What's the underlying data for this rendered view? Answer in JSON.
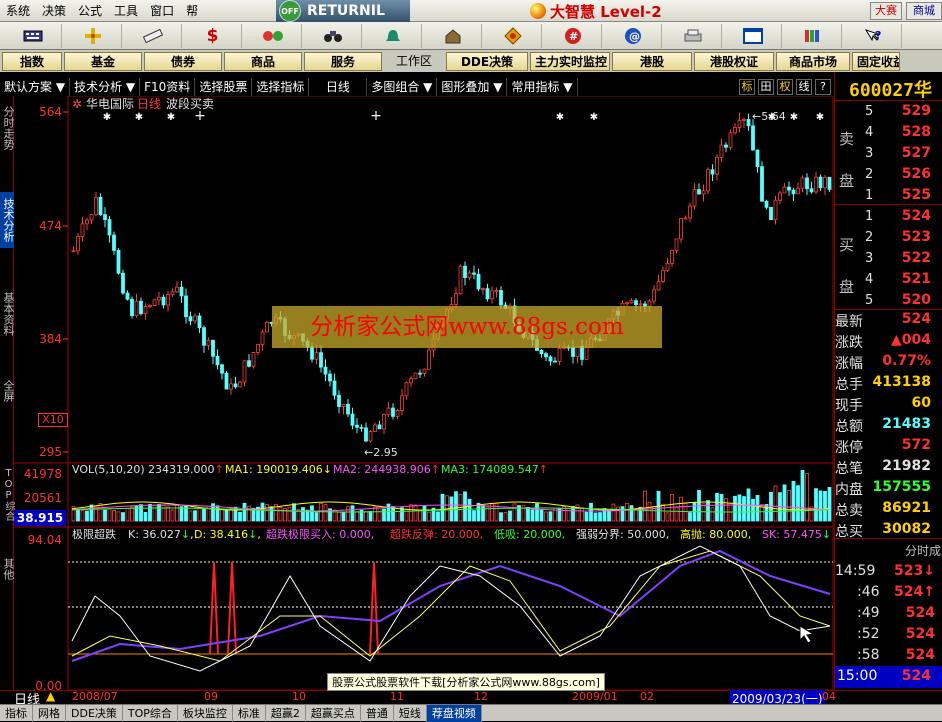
{
  "menubar": {
    "items": [
      "系统",
      "决策",
      "公式",
      "工具",
      "窗口",
      "帮"
    ],
    "returnil_badge": "OFF",
    "returnil_label": "RETURNIL",
    "brand": "大智慧 Level-2",
    "tournament": "大赛",
    "mall": "商城"
  },
  "toolbar": {
    "items": [
      {
        "icon": "keyboard-icon"
      },
      {
        "icon": "crosshair-icon"
      },
      {
        "icon": "ruler-icon"
      },
      {
        "icon": "dollar-icon",
        "label": "$"
      },
      {
        "icon": "coins-icon"
      },
      {
        "icon": "binoculars-icon"
      },
      {
        "icon": "bell-icon"
      },
      {
        "icon": "house-icon"
      },
      {
        "icon": "diamond-icon"
      },
      {
        "icon": "shield-icon"
      },
      {
        "icon": "disc-icon"
      },
      {
        "icon": "printer-icon"
      },
      {
        "icon": "window-icon"
      },
      {
        "icon": "books-icon"
      },
      {
        "icon": "help-icon"
      }
    ]
  },
  "funcbar": {
    "buttons": [
      "指数",
      "基金",
      "债券",
      "商品",
      "服务"
    ],
    "work_area": "工作区",
    "buttons2": [
      "DDE决策",
      "主力实时监控",
      "港股",
      "港股权证",
      "商品市场",
      "固定收益"
    ]
  },
  "menurow": {
    "items": [
      "默认方案",
      "技术分析",
      "F10资料",
      "选择股票",
      "选择指标",
      "日线",
      "多图组合",
      "图形叠加",
      "常用指标"
    ],
    "icons": [
      "标",
      "田",
      "权",
      "线",
      "?"
    ]
  },
  "left_tabs": [
    "分时走势",
    "技术分析",
    "基本资料",
    "全屏",
    "TOP综合",
    "其他"
  ],
  "kline": {
    "stock_name": "华电国际",
    "period": "日线",
    "indicator": "波段买卖",
    "yticks": [
      "564",
      "474",
      "384",
      "295"
    ],
    "high_label": "5.64",
    "low_label": "2.95",
    "colors": {
      "up": "#ff3c3c",
      "down": "#54ffff"
    }
  },
  "volume": {
    "title": "VOL(5,10,20)",
    "vol": "234319.000",
    "ma1_label": "MA1: 190019.406",
    "ma2_label": "MA2: 244938.906",
    "ma3_label": "MA3: 174089.547",
    "yticks": [
      "41978",
      "20561",
      "X10"
    ]
  },
  "indicator": {
    "title": "极限超跌",
    "k_label": "K: 36.027",
    "d_label": "D: 38.416",
    "buy_label": "超跌极限买入: 0.000,",
    "rebound_label": "超跌反弹: 20.000,",
    "low_label": "低吸: 20.000,",
    "strength_label": "强弱分界: 50.000,",
    "throw_label": "高抛: 80.000,",
    "sk_label": "SK: 57.475",
    "yticks": [
      "94.04",
      "38.915",
      "0.00"
    ]
  },
  "timeaxis": {
    "period": "日线",
    "labels": [
      "2008/07",
      "09",
      "10",
      "11",
      "12",
      "2009/01",
      "02"
    ],
    "current_date": "2009/03/23(一)",
    "end": "04"
  },
  "sidebar": {
    "code": "600027",
    "code_suffix": "华",
    "sell_label": [
      "卖",
      "盘"
    ],
    "buy_label": [
      "买",
      "盘"
    ],
    "sells": [
      {
        "level": "5",
        "price": "529"
      },
      {
        "level": "4",
        "price": "528"
      },
      {
        "level": "3",
        "price": "527"
      },
      {
        "level": "2",
        "price": "526"
      },
      {
        "level": "1",
        "price": "525"
      }
    ],
    "buys": [
      {
        "level": "1",
        "price": "524"
      },
      {
        "level": "2",
        "price": "523"
      },
      {
        "level": "3",
        "price": "522"
      },
      {
        "level": "4",
        "price": "521"
      },
      {
        "level": "5",
        "price": "520"
      }
    ],
    "quotes": [
      {
        "label": "最新",
        "value": "524",
        "color": "#ff3030"
      },
      {
        "label": "涨跌",
        "value": "▲004",
        "color": "#ff3030"
      },
      {
        "label": "涨幅",
        "value": "0.77%",
        "color": "#ff3030"
      },
      {
        "label": "总手",
        "value": "413138",
        "color": "#ffd000"
      },
      {
        "label": "现手",
        "value": "60",
        "color": "#ffd000"
      },
      {
        "label": "总额",
        "value": "21483",
        "color": "#54ffff"
      },
      {
        "label": "涨停",
        "value": "572",
        "color": "#ff3030"
      },
      {
        "label": "总笔",
        "value": "21982",
        "color": "#e0e0e0"
      },
      {
        "label": "内盘",
        "value": "157555",
        "color": "#30ff30"
      },
      {
        "label": "总卖",
        "value": "86921",
        "color": "#ffd000"
      },
      {
        "label": "总买",
        "value": "30082",
        "color": "#ffd000"
      }
    ],
    "tick_header": "分时成",
    "ticks": [
      {
        "time": "14:59",
        "price": "523",
        "arrow": "↓"
      },
      {
        "time": ":46",
        "price": "524",
        "arrow": "↑"
      },
      {
        "time": ":49",
        "price": "524",
        "arrow": ""
      },
      {
        "time": ":52",
        "price": "524",
        "arrow": ""
      },
      {
        "time": ":58",
        "price": "524",
        "arrow": ""
      }
    ],
    "close_time": "15:00",
    "close_price": "524"
  },
  "bottom_tabs": [
    "指标",
    "网格",
    "DDE决策",
    "TOP综合",
    "板块监控",
    "标准",
    "超赢2",
    "超赢买点",
    "普通",
    "短线",
    "荐盘视频"
  ],
  "ad_text": "股票公式股票软件下载[分析家公式网www.88gs.com]",
  "watermark": "分析家公式网www.88gs.com"
}
